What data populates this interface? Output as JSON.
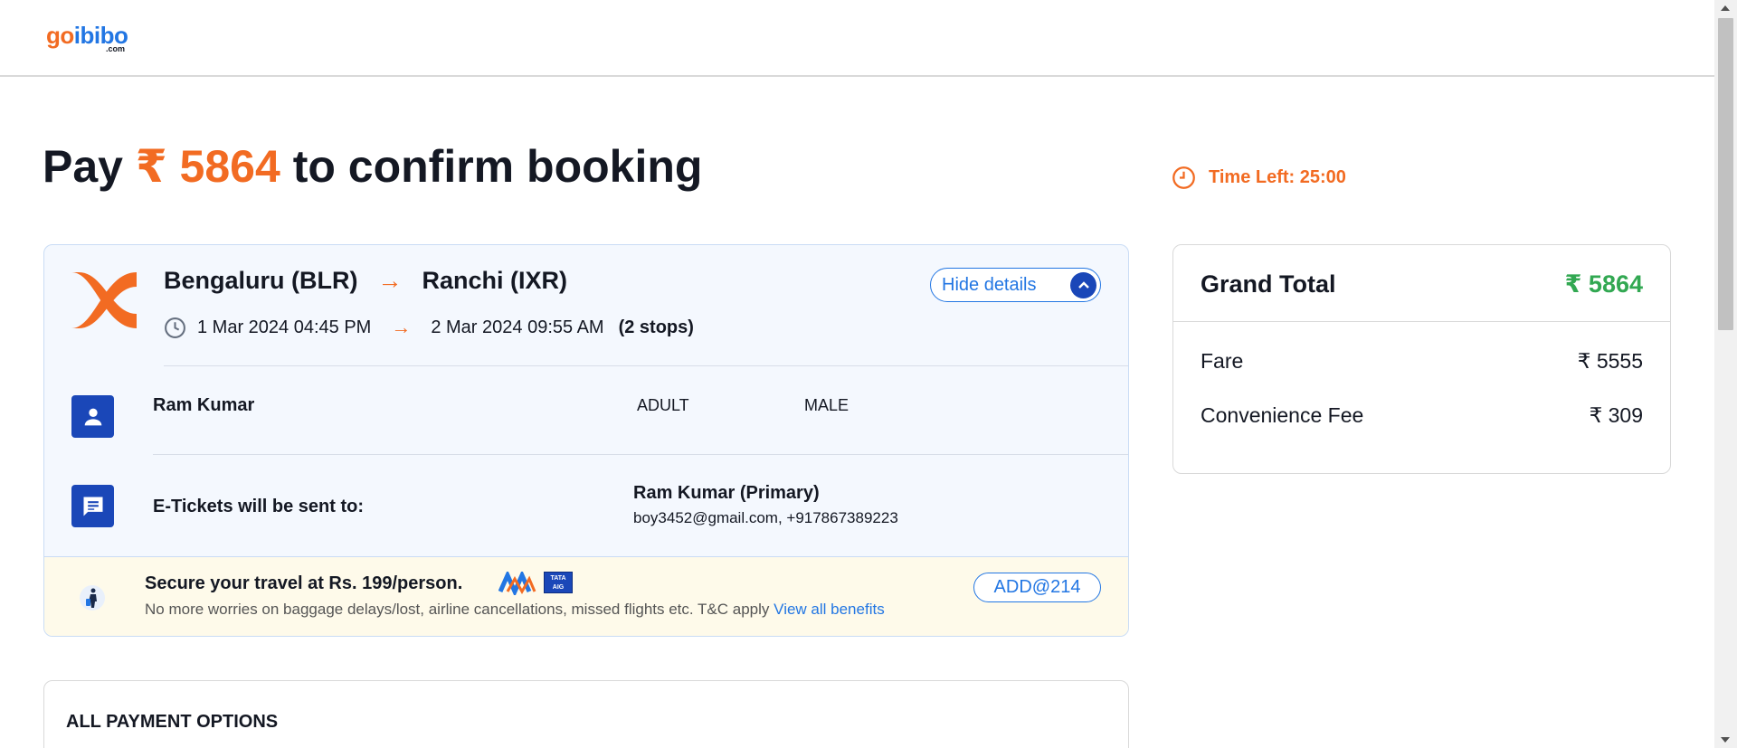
{
  "header": {
    "logo": {
      "go": "go",
      "ibibo": "ibibo",
      "dotcom": ".com"
    }
  },
  "title": {
    "prefix": "Pay",
    "amount": "₹ 5864",
    "suffix": "to confirm booking"
  },
  "timer": {
    "icon": "clock-icon",
    "text": "Time Left: 25:00"
  },
  "trip": {
    "airline_icon": "airline-logo",
    "from": "Bengaluru (BLR)",
    "arrow": "→",
    "to": "Ranchi (IXR)",
    "depart": "1 Mar 2024 04:45 PM",
    "arrive": "2 Mar 2024 09:55 AM",
    "stops": "(2 stops)",
    "hide_details": "Hide details"
  },
  "passenger": {
    "icon": "person-icon",
    "name": "Ram Kumar",
    "type": "ADULT",
    "gender": "MALE"
  },
  "eticket": {
    "icon": "message-icon",
    "label": "E-Tickets will be sent to:",
    "contact_name": "Ram Kumar (Primary)",
    "contact_detail": "boy3452@gmail.com, +917867389223"
  },
  "insurance": {
    "icon": "traveler-icon",
    "title": "Secure your travel at Rs. 199/person.",
    "brand_tata": "TATA AIG",
    "subtitle": "No more worries on baggage delays/lost, airline cancellations, missed flights etc. T&C apply",
    "link": "View all benefits",
    "add_button": "ADD@214"
  },
  "payment": {
    "title": "ALL PAYMENT OPTIONS"
  },
  "summary": {
    "grand_total_label": "Grand Total",
    "grand_total_value": "₹ 5864",
    "rows": [
      {
        "label": "Fare",
        "value": "₹ 5555"
      },
      {
        "label": "Convenience Fee",
        "value": "₹ 309"
      }
    ]
  },
  "colors": {
    "accent_orange": "#f26b22",
    "brand_blue": "#2276e3",
    "dark_blue": "#1a47b8",
    "total_green": "#32a852"
  }
}
